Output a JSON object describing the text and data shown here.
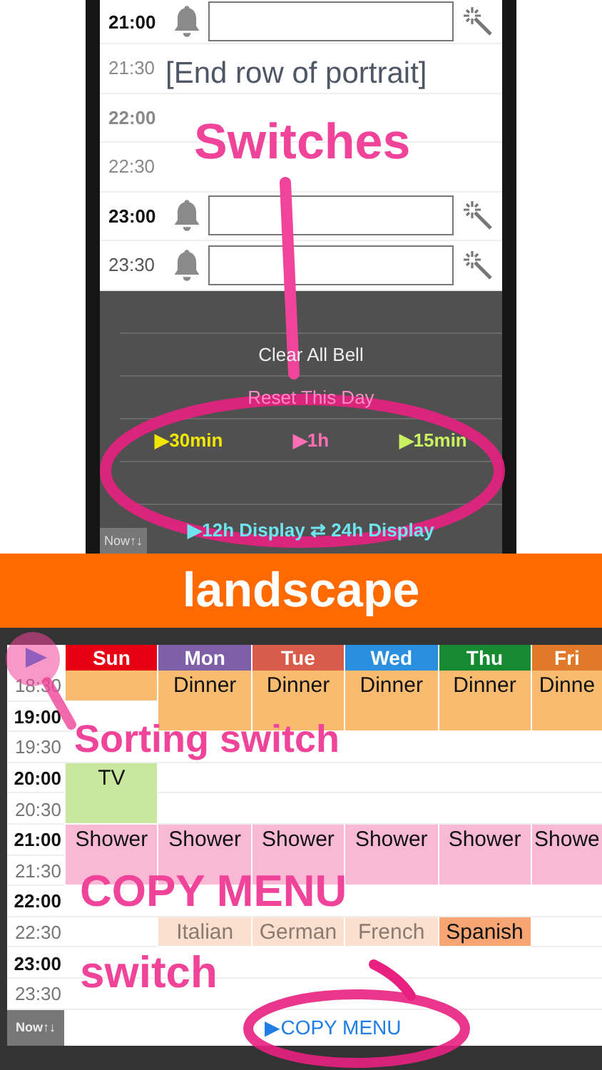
{
  "portrait": {
    "rows": [
      {
        "time": "21:00",
        "bold": true,
        "dimmed": false
      },
      {
        "time": "21:30",
        "bold": false,
        "dimmed": true
      },
      {
        "time": "22:00",
        "bold": true,
        "dimmed": true
      },
      {
        "time": "22:30",
        "bold": false,
        "dimmed": true
      },
      {
        "time": "23:00",
        "bold": true,
        "dimmed": false
      },
      {
        "time": "23:30",
        "bold": false,
        "dimmed": false
      }
    ],
    "menu": [
      {
        "kind": "blank"
      },
      {
        "kind": "action",
        "label": "Clear All Bell"
      },
      {
        "kind": "faded",
        "label": "Reset This Day"
      },
      {
        "kind": "switches",
        "options": [
          {
            "label": "▶30min",
            "color": "#f2e600"
          },
          {
            "label": "▶1h",
            "color": "#ff6fb5"
          },
          {
            "label": "▶15min",
            "color": "#c8f060"
          }
        ]
      },
      {
        "kind": "blank"
      },
      {
        "kind": "display",
        "label": "▶12h Display ⇄ 24h Display"
      }
    ],
    "now_button": "Now↑↓"
  },
  "banner": "landscape",
  "landscape": {
    "times": [
      {
        "time": "18:30",
        "bold": false
      },
      {
        "time": "19:00",
        "bold": true
      },
      {
        "time": "19:30",
        "bold": false
      },
      {
        "time": "20:00",
        "bold": true
      },
      {
        "time": "20:30",
        "bold": false
      },
      {
        "time": "21:00",
        "bold": true
      },
      {
        "time": "21:30",
        "bold": false
      },
      {
        "time": "22:00",
        "bold": true
      },
      {
        "time": "22:30",
        "bold": false
      },
      {
        "time": "23:00",
        "bold": true
      },
      {
        "time": "23:30",
        "bold": false
      }
    ],
    "days": [
      {
        "label": "Sun",
        "color": "#e60012",
        "slots": [
          {
            "kind": "half",
            "color": "#f9bb6f"
          },
          {
            "kind": "blank"
          },
          {
            "kind": "blank"
          },
          {
            "kind": "hour",
            "label": "TV",
            "color": "#c9e79e",
            "dimmed": false
          },
          {
            "kind": "hour",
            "label": "Shower",
            "color": "#f9b8d3",
            "dimmed": false
          }
        ]
      },
      {
        "label": "Mon",
        "color": "#7e5fa8",
        "slots": [
          {
            "kind": "hour",
            "label": "Dinner",
            "color": "#f9bb6f",
            "dimmed": false
          },
          {
            "kind": "blank"
          },
          {
            "kind": "blank"
          },
          {
            "kind": "blank"
          },
          {
            "kind": "hour",
            "label": "Shower",
            "color": "#f9b8d3",
            "dimmed": false
          },
          {
            "kind": "blank"
          },
          {
            "kind": "half",
            "label": "Italian",
            "color": "#fce0cf",
            "dimmed": true
          }
        ]
      },
      {
        "label": "Tue",
        "color": "#d95b4a",
        "slots": [
          {
            "kind": "hour",
            "label": "Dinner",
            "color": "#f9bb6f",
            "dimmed": false
          },
          {
            "kind": "blank"
          },
          {
            "kind": "blank"
          },
          {
            "kind": "blank"
          },
          {
            "kind": "hour",
            "label": "Shower",
            "color": "#f9b8d3",
            "dimmed": false
          },
          {
            "kind": "blank"
          },
          {
            "kind": "half",
            "label": "German",
            "color": "#fce0cf",
            "dimmed": true
          }
        ]
      },
      {
        "label": "Wed",
        "color": "#2b8fe0",
        "slots": [
          {
            "kind": "hour",
            "label": "Dinner",
            "color": "#f9bb6f",
            "dimmed": false
          },
          {
            "kind": "blank"
          },
          {
            "kind": "blank"
          },
          {
            "kind": "blank"
          },
          {
            "kind": "hour",
            "label": "Shower",
            "color": "#f9b8d3",
            "dimmed": false
          },
          {
            "kind": "blank"
          },
          {
            "kind": "half",
            "label": "French",
            "color": "#fce0cf",
            "dimmed": true
          }
        ]
      },
      {
        "label": "Thu",
        "color": "#168a30",
        "slots": [
          {
            "kind": "hour",
            "label": "Dinner",
            "color": "#f9bb6f",
            "dimmed": false
          },
          {
            "kind": "blank"
          },
          {
            "kind": "blank"
          },
          {
            "kind": "blank"
          },
          {
            "kind": "hour",
            "label": "Shower",
            "color": "#f9b8d3",
            "dimmed": false
          },
          {
            "kind": "blank"
          },
          {
            "kind": "half",
            "label": "Spanish",
            "color": "#f7a572",
            "dimmed": false
          }
        ]
      },
      {
        "label": "Fri",
        "color": "#e07a2a",
        "slots": [
          {
            "kind": "hour",
            "label": "Dinne",
            "color": "#f9bb6f",
            "dimmed": false
          },
          {
            "kind": "blank"
          },
          {
            "kind": "blank"
          },
          {
            "kind": "blank"
          },
          {
            "kind": "hour",
            "label": "Showe",
            "color": "#f9b8d3",
            "dimmed": false
          }
        ]
      }
    ],
    "now_button": "Now↑↓",
    "copy_menu": "▶COPY MENU"
  },
  "annotations": [
    {
      "kind": "end_note",
      "text": "[End row of portrait]"
    },
    {
      "kind": "switches",
      "text": "Switches"
    },
    {
      "kind": "sorting",
      "text": "Sorting switch"
    },
    {
      "kind": "copy",
      "text": "COPY MENU"
    },
    {
      "kind": "copy_second",
      "text": "switch"
    }
  ]
}
